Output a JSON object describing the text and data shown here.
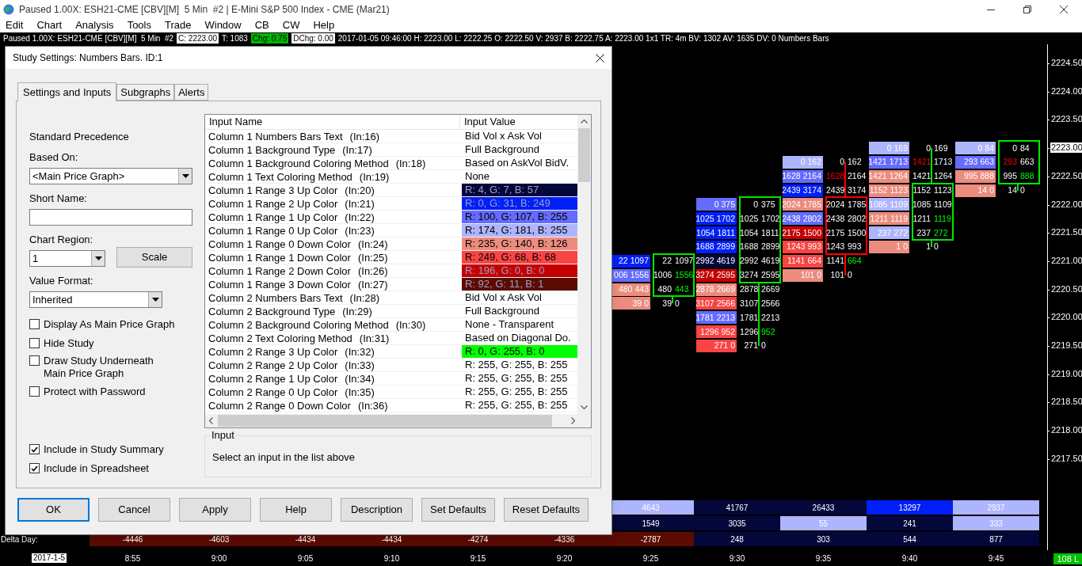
{
  "window": {
    "title": "Paused 1.00X: ESH21-CME [CBV][M]  5 Min  #2 | E-Mini S&P 500 Index - CME (Mar21)"
  },
  "menu": [
    "Edit",
    "Chart",
    "Analysis",
    "Tools",
    "Trade",
    "Window",
    "CB",
    "CW",
    "Help"
  ],
  "info_bar": [
    {
      "text": "Paused 1.00X: ESH21-CME [CBV][M]  5 Min  #2",
      "kind": "plain"
    },
    {
      "text": "C: 2223.00",
      "kind": "boxed"
    },
    {
      "text": "T: 1083",
      "kind": "plain"
    },
    {
      "text": "Chg: 0.75",
      "kind": "up"
    },
    {
      "text": "DChg: 0.00",
      "kind": "boxed"
    },
    {
      "text": "2017-01-05 09:46:00 H: 2223.00 L: 2222.25 O: 2222.50 V: 2937 B: 2222.75 A: 2223.00 1x1 TR: 4m BV: 1302 AV: 1635 DV: 0 Numbers Bars",
      "kind": "plain"
    }
  ],
  "chart": {
    "price_axis": [
      {
        "label": "2224.50",
        "current": false
      },
      {
        "label": "2224.00",
        "current": false
      },
      {
        "label": "2223.50",
        "current": false
      },
      {
        "label": "2223.00",
        "current": true
      },
      {
        "label": "2222.50",
        "current": false
      },
      {
        "label": "2222.00",
        "current": false
      },
      {
        "label": "2221.50",
        "current": false
      },
      {
        "label": "2221.00",
        "current": false
      },
      {
        "label": "2220.50",
        "current": false
      },
      {
        "label": "2220.00",
        "current": false
      },
      {
        "label": "2219.50",
        "current": false
      },
      {
        "label": "2219.00",
        "current": false
      },
      {
        "label": "2218.50",
        "current": false
      },
      {
        "label": "2218.00",
        "current": false
      },
      {
        "label": "2217.50",
        "current": false
      }
    ],
    "bars": [
      {
        "bullish": true,
        "body": [
          {
            "shaded": {
              "bid": "22",
              "ask": "1097",
              "color": "#001ff9"
            },
            "plain": {
              "bid": "22",
              "ask": "1097",
              "bid_imbalance": false,
              "ask_imbalance": false
            }
          },
          {
            "shaded": {
              "bid": "006",
              "ask": "1556",
              "color": "#646bff"
            },
            "plain": {
              "bid": "1006",
              "ask": "1556",
              "bid_imbalance": false,
              "ask_imbalance": true
            }
          },
          {
            "shaded": {
              "bid": "480",
              "ask": "443",
              "color": "#eb8c7e"
            },
            "plain": {
              "bid": "480",
              "ask": "443",
              "bid_imbalance": false,
              "ask_imbalance": true
            }
          }
        ],
        "lower_wick": [
          {
            "shaded": {
              "bid": "39",
              "ask": "0",
              "color": "#eb8c7e"
            },
            "plain": {
              "bid": "39",
              "ask": "0",
              "bid_imbalance": false,
              "ask_imbalance": false
            }
          }
        ]
      },
      {
        "bullish": true,
        "body": [
          {
            "shaded": {
              "bid": "0",
              "ask": "375",
              "color": "#646bff"
            },
            "plain": {
              "bid": "0",
              "ask": "375",
              "bid_imbalance": false,
              "ask_imbalance": false
            }
          },
          {
            "shaded": {
              "bid": "1025",
              "ask": "1702",
              "color": "#001ff9"
            },
            "plain": {
              "bid": "1025",
              "ask": "1702",
              "bid_imbalance": false,
              "ask_imbalance": false
            }
          },
          {
            "shaded": {
              "bid": "1054",
              "ask": "1811",
              "color": "#001ff9"
            },
            "plain": {
              "bid": "1054",
              "ask": "1811",
              "bid_imbalance": false,
              "ask_imbalance": false
            }
          },
          {
            "shaded": {
              "bid": "1688",
              "ask": "2899",
              "color": "#001ff9"
            },
            "plain": {
              "bid": "1688",
              "ask": "2899",
              "bid_imbalance": false,
              "ask_imbalance": false
            }
          },
          {
            "shaded": {
              "bid": "2992",
              "ask": "4619",
              "color": "#040739"
            },
            "plain": {
              "bid": "2992",
              "ask": "4619",
              "bid_imbalance": false,
              "ask_imbalance": false
            }
          },
          {
            "shaded": {
              "bid": "3274",
              "ask": "2595",
              "color": "#c40000"
            },
            "plain": {
              "bid": "3274",
              "ask": "2595",
              "bid_imbalance": false,
              "ask_imbalance": false
            }
          }
        ],
        "lower_wick": [
          {
            "shaded": {
              "bid": "2878",
              "ask": "2669",
              "color": "#eb8c7e"
            },
            "plain": {
              "bid": "2878",
              "ask": "2669",
              "bid_imbalance": false,
              "ask_imbalance": false
            }
          },
          {
            "shaded": {
              "bid": "3107",
              "ask": "2566",
              "color": "#f94444"
            },
            "plain": {
              "bid": "3107",
              "ask": "2566",
              "bid_imbalance": false,
              "ask_imbalance": false
            }
          },
          {
            "shaded": {
              "bid": "1781",
              "ask": "2213",
              "color": "#646bff"
            },
            "plain": {
              "bid": "1781",
              "ask": "2213",
              "bid_imbalance": false,
              "ask_imbalance": false
            }
          },
          {
            "shaded": {
              "bid": "1296",
              "ask": "952",
              "color": "#f94444"
            },
            "plain": {
              "bid": "1296",
              "ask": "952",
              "bid_imbalance": false,
              "ask_imbalance": true
            }
          },
          {
            "shaded": {
              "bid": "271",
              "ask": "0",
              "color": "#f94444"
            },
            "plain": {
              "bid": "271",
              "ask": "0",
              "bid_imbalance": false,
              "ask_imbalance": false
            }
          }
        ]
      },
      {
        "bullish": false,
        "upper_wick": [
          {
            "shaded": {
              "bid": "0",
              "ask": "162",
              "color": "#aeb5ff"
            },
            "plain": {
              "bid": "0",
              "ask": "162",
              "bid_imbalance": false,
              "ask_imbalance": false
            }
          },
          {
            "shaded": {
              "bid": "1628",
              "ask": "2164",
              "color": "#646bff"
            },
            "plain": {
              "bid": "1628",
              "ask": "2164",
              "bid_imbalance": true,
              "ask_imbalance": false
            }
          },
          {
            "shaded": {
              "bid": "2439",
              "ask": "3174",
              "color": "#001ff9"
            },
            "plain": {
              "bid": "2439",
              "ask": "3174",
              "bid_imbalance": false,
              "ask_imbalance": false
            }
          }
        ],
        "body": [
          {
            "shaded": {
              "bid": "2024",
              "ask": "1785",
              "color": "#eb8c7e"
            },
            "plain": {
              "bid": "2024",
              "ask": "1785",
              "bid_imbalance": false,
              "ask_imbalance": false
            }
          },
          {
            "shaded": {
              "bid": "2438",
              "ask": "2802",
              "color": "#646bff"
            },
            "plain": {
              "bid": "2438",
              "ask": "2802",
              "bid_imbalance": false,
              "ask_imbalance": false
            }
          },
          {
            "shaded": {
              "bid": "2175",
              "ask": "1500",
              "color": "#c40000"
            },
            "plain": {
              "bid": "2175",
              "ask": "1500",
              "bid_imbalance": false,
              "ask_imbalance": false
            }
          },
          {
            "shaded": {
              "bid": "1243",
              "ask": "993",
              "color": "#f94444"
            },
            "plain": {
              "bid": "1243",
              "ask": "993",
              "bid_imbalance": false,
              "ask_imbalance": false
            }
          }
        ],
        "lower_wick": [
          {
            "shaded": {
              "bid": "1141",
              "ask": "664",
              "color": "#f94444"
            },
            "plain": {
              "bid": "1141",
              "ask": "664",
              "bid_imbalance": false,
              "ask_imbalance": true
            }
          },
          {
            "shaded": {
              "bid": "101",
              "ask": "0",
              "color": "#eb8c7e"
            },
            "plain": {
              "bid": "101",
              "ask": "0",
              "bid_imbalance": false,
              "ask_imbalance": false
            }
          }
        ]
      },
      {
        "bullish": true,
        "upper_wick": [
          {
            "shaded": {
              "bid": "0",
              "ask": "169",
              "color": "#aeb5ff"
            },
            "plain": {
              "bid": "0",
              "ask": "169",
              "bid_imbalance": false,
              "ask_imbalance": false
            }
          },
          {
            "shaded": {
              "bid": "1421",
              "ask": "1713",
              "color": "#646bff"
            },
            "plain": {
              "bid": "1421",
              "ask": "1713",
              "bid_imbalance": true,
              "ask_imbalance": false
            }
          },
          {
            "shaded": {
              "bid": "1421",
              "ask": "1264",
              "color": "#eb8c7e"
            },
            "plain": {
              "bid": "1421",
              "ask": "1264",
              "bid_imbalance": false,
              "ask_imbalance": false
            }
          }
        ],
        "body": [
          {
            "shaded": {
              "bid": "1152",
              "ask": "1123",
              "color": "#eb8c7e"
            },
            "plain": {
              "bid": "1152",
              "ask": "1123",
              "bid_imbalance": false,
              "ask_imbalance": false
            }
          },
          {
            "shaded": {
              "bid": "1085",
              "ask": "1109",
              "color": "#aeb5ff"
            },
            "plain": {
              "bid": "1085",
              "ask": "1109",
              "bid_imbalance": false,
              "ask_imbalance": false
            }
          },
          {
            "shaded": {
              "bid": "1211",
              "ask": "1119",
              "color": "#eb8c7e"
            },
            "plain": {
              "bid": "1211",
              "ask": "1119",
              "bid_imbalance": false,
              "ask_imbalance": true
            }
          },
          {
            "shaded": {
              "bid": "237",
              "ask": "272",
              "color": "#aeb5ff"
            },
            "plain": {
              "bid": "237",
              "ask": "272",
              "bid_imbalance": false,
              "ask_imbalance": true
            }
          }
        ],
        "lower_wick": [
          {
            "shaded": {
              "bid": "1",
              "ask": "0",
              "color": "#eb8c7e"
            },
            "plain": {
              "bid": "1",
              "ask": "0",
              "bid_imbalance": false,
              "ask_imbalance": false
            }
          }
        ]
      },
      {
        "bullish": true,
        "body": [
          {
            "shaded": {
              "bid": "0",
              "ask": "84",
              "color": "#aeb5ff"
            },
            "plain": {
              "bid": "0",
              "ask": "84",
              "bid_imbalance": false,
              "ask_imbalance": false
            }
          },
          {
            "shaded": {
              "bid": "293",
              "ask": "663",
              "color": "#646bff"
            },
            "plain": {
              "bid": "293",
              "ask": "663",
              "bid_imbalance": true,
              "ask_imbalance": false
            }
          },
          {
            "shaded": {
              "bid": "995",
              "ask": "888",
              "color": "#eb8c7e"
            },
            "plain": {
              "bid": "995",
              "ask": "888",
              "bid_imbalance": false,
              "ask_imbalance": true
            }
          }
        ],
        "lower_wick": [
          {
            "shaded": {
              "bid": "14",
              "ask": "0",
              "color": "#eb8c7e"
            },
            "plain": {
              "bid": "14",
              "ask": "0",
              "bid_imbalance": false,
              "ask_imbalance": false
            }
          }
        ]
      }
    ],
    "summary_rows": [
      {
        "cells": [
          null,
          null,
          null,
          null,
          null,
          null,
          {
            "value": "4643",
            "color": "#aeb5ff"
          },
          {
            "value": "41767",
            "color": "#040739"
          },
          {
            "value": "26433",
            "color": "#040739"
          },
          {
            "value": "13297",
            "color": "#001ff9"
          },
          {
            "value": "2937",
            "color": "#aeb5ff"
          }
        ]
      },
      {
        "cells": [
          null,
          null,
          null,
          null,
          null,
          null,
          {
            "value": "1549",
            "color": "#040739"
          },
          {
            "value": "3035",
            "color": "#040739"
          },
          {
            "value": "55",
            "color": "#aeb5ff"
          },
          {
            "value": "241",
            "color": "#040739"
          },
          {
            "value": "333",
            "color": "#aeb5ff"
          }
        ]
      },
      {
        "label": "Delta Day:",
        "cells": [
          {
            "value": "-4446",
            "color": "#5c0b01"
          },
          {
            "value": "-4603",
            "color": "#5c0b01"
          },
          {
            "value": "-4434",
            "color": "#5c0b01"
          },
          {
            "value": "-4434",
            "color": "#5c0b01"
          },
          {
            "value": "-4274",
            "color": "#5c0b01"
          },
          {
            "value": "-4336",
            "color": "#5c0b01"
          },
          {
            "value": "-2787",
            "color": "#5c0b01"
          },
          {
            "value": "248",
            "color": "#040739"
          },
          {
            "value": "303",
            "color": "#040739"
          },
          {
            "value": "544",
            "color": "#040739"
          },
          {
            "value": "877",
            "color": "#040739"
          }
        ]
      }
    ],
    "time_axis": {
      "date": "2017-1-5",
      "times": [
        "8:55",
        "9:00",
        "9:05",
        "9:10",
        "9:15",
        "9:20",
        "9:25",
        "9:30",
        "9:35",
        "9:40",
        "9:45"
      ]
    },
    "status_badge": "108 L"
  },
  "dialog": {
    "title": "Study Settings: Numbers Bars. ID:1",
    "tabs": [
      {
        "label": "Settings and Inputs",
        "selected": true
      },
      {
        "label": "Subgraphs",
        "selected": false
      },
      {
        "label": "Alerts",
        "selected": false
      }
    ],
    "precedence": "Standard Precedence",
    "based_on": {
      "label": "Based On:",
      "value": "<Main Price Graph>"
    },
    "short_name": {
      "label": "Short Name:"
    },
    "chart_region": {
      "label": "Chart Region:",
      "value": "1"
    },
    "scale_button": "Scale",
    "value_format": {
      "label": "Value Format:",
      "value": "Inherited"
    },
    "options": [
      {
        "label": "Display As Main Price Graph",
        "checked": false
      },
      {
        "label": "Hide Study",
        "checked": false
      },
      {
        "label": "Draw Study Underneath Main Price Graph",
        "checked": false
      },
      {
        "label": "Protect with Password",
        "checked": false
      }
    ],
    "include_options": [
      {
        "label": "Include in Study Summary",
        "checked": true
      },
      {
        "label": "Include in Spreadsheet",
        "checked": true
      }
    ],
    "inputs": {
      "columns": [
        "Input Name",
        "Input Value"
      ],
      "rows": [
        {
          "name": "Column 1 Numbers Bars Text",
          "number": "(In:16)",
          "kind": "text",
          "value": "Bid Vol x Ask Vol"
        },
        {
          "name": "Column 1 Background Type",
          "number": "(In:17)",
          "kind": "text",
          "value": "Full Background"
        },
        {
          "name": "Column 1 Background Coloring Method",
          "number": "(In:18)",
          "kind": "text",
          "value": "Based on AskVol BidV."
        },
        {
          "name": "Column 1 Text Coloring Method",
          "number": "(In:19)",
          "kind": "text",
          "value": "None"
        },
        {
          "name": "Column 1 Range 3 Up Color",
          "number": "(In:20)",
          "kind": "color",
          "value": "R: 4, G: 7, B: 57",
          "color": "#040739"
        },
        {
          "name": "Column 1 Range 2 Up Color",
          "number": "(In:21)",
          "kind": "color",
          "value": "R: 0, G: 31, B: 249",
          "color": "#001ff9"
        },
        {
          "name": "Column 1 Range 1 Up Color",
          "number": "(In:22)",
          "kind": "color",
          "value": "R: 100, G: 107, B: 255",
          "color": "#646bff"
        },
        {
          "name": "Column 1 Range 0 Up Color",
          "number": "(In:23)",
          "kind": "color",
          "value": "R: 174, G: 181, B: 255",
          "color": "#aeb5ff"
        },
        {
          "name": "Column 1 Range 0 Down Color",
          "number": "(In:24)",
          "kind": "color",
          "value": "R: 235, G: 140, B: 126",
          "color": "#eb8c7e"
        },
        {
          "name": "Column 1 Range 1 Down Color",
          "number": "(In:25)",
          "kind": "color",
          "value": "R: 249, G: 68, B: 68",
          "color": "#f94444"
        },
        {
          "name": "Column 1 Range 2 Down Color",
          "number": "(In:26)",
          "kind": "color",
          "value": "R: 196, G: 0, B: 0",
          "color": "#c40000"
        },
        {
          "name": "Column 1 Range 3 Down Color",
          "number": "(In:27)",
          "kind": "color",
          "value": "R: 92, G: 11, B: 1",
          "color": "#5c0b01"
        },
        {
          "name": "Column 2 Numbers Bars Text",
          "number": "(In:28)",
          "kind": "text",
          "value": "Bid Vol x Ask Vol"
        },
        {
          "name": "Column 2 Background Type",
          "number": "(In:29)",
          "kind": "text",
          "value": "Full Background"
        },
        {
          "name": "Column 2 Background Coloring Method",
          "number": "(In:30)",
          "kind": "text",
          "value": "None - Transparent"
        },
        {
          "name": "Column 2 Text Coloring Method",
          "number": "(In:31)",
          "kind": "text",
          "value": "Based on Diagonal Do."
        },
        {
          "name": "Column 2 Range 3 Up Color",
          "number": "(In:32)",
          "kind": "color",
          "value": "R: 0, G: 255, B: 0",
          "color": "#00ff00"
        },
        {
          "name": "Column 2 Range 2 Up Color",
          "number": "(In:33)",
          "kind": "color",
          "value": "R: 255, G: 255, B: 255",
          "color": "#ffffff"
        },
        {
          "name": "Column 2 Range 1 Up Color",
          "number": "(In:34)",
          "kind": "color",
          "value": "R: 255, G: 255, B: 255",
          "color": "#ffffff"
        },
        {
          "name": "Column 2 Range 0 Up Color",
          "number": "(In:35)",
          "kind": "color",
          "value": "R: 255, G: 255, B: 255",
          "color": "#ffffff"
        },
        {
          "name": "Column 2 Range 0 Down Color",
          "number": "(In:36)",
          "kind": "color",
          "value": "R: 255, G: 255, B: 255",
          "color": "#ffffff"
        }
      ]
    },
    "input_help": {
      "title": "Input",
      "text": "Select an input in the list above"
    },
    "buttons": [
      "OK",
      "Cancel",
      "Apply",
      "Help",
      "Description",
      "Set Defaults",
      "Reset Defaults"
    ]
  }
}
